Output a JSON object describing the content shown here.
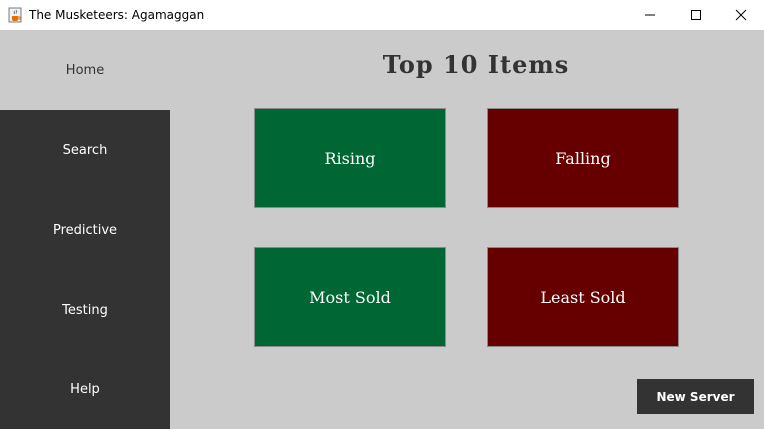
{
  "window": {
    "title": "The Musketeers: Agamaggan"
  },
  "sidebar": {
    "items": [
      {
        "label": "Home"
      },
      {
        "label": "Search"
      },
      {
        "label": "Predictive"
      },
      {
        "label": "Testing"
      },
      {
        "label": "Help"
      }
    ]
  },
  "main": {
    "title": "Top 10 Items",
    "tiles": [
      {
        "label": "Rising",
        "color": "#006633"
      },
      {
        "label": "Falling",
        "color": "#660000"
      },
      {
        "label": "Most Sold",
        "color": "#006633"
      },
      {
        "label": "Least Sold",
        "color": "#660000"
      }
    ],
    "new_server_label": "New Server"
  },
  "colors": {
    "background": "#cbcbcb",
    "dark": "#333333",
    "green": "#006633",
    "red": "#660000"
  },
  "icons": {
    "app": "java-cup-icon",
    "minimize": "minimize-icon",
    "maximize": "maximize-icon",
    "close": "close-icon"
  }
}
